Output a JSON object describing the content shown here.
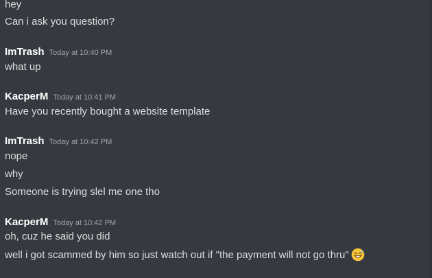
{
  "messages": [
    {
      "text": "hey"
    },
    {
      "text": "Can i ask you question?"
    },
    {
      "author": "ImTrash",
      "timestamp": "Today at 10:40 PM"
    },
    {
      "text": "what up"
    },
    {
      "author": "KacperM",
      "timestamp": "Today at 10:41 PM"
    },
    {
      "text": "Have you recently bought a website template"
    },
    {
      "author": "ImTrash",
      "timestamp": "Today at 10:42 PM"
    },
    {
      "text": "nope"
    },
    {
      "text": "why"
    },
    {
      "text": "Someone is trying slel me one tho"
    },
    {
      "author": "KacperM",
      "timestamp": "Today at 10:42 PM"
    },
    {
      "text": "oh, cuz he said you did"
    },
    {
      "text": "well i got scammed by him so just watch out if \"the payment will not go thru\"",
      "emoji": "grinning-sweat-face-icon"
    }
  ],
  "colors": {
    "background": "#36393f",
    "message_text": "#dcddde",
    "author_name": "#ffffff",
    "timestamp": "#a3a6aa",
    "emoji_face": "#f8c43a"
  }
}
